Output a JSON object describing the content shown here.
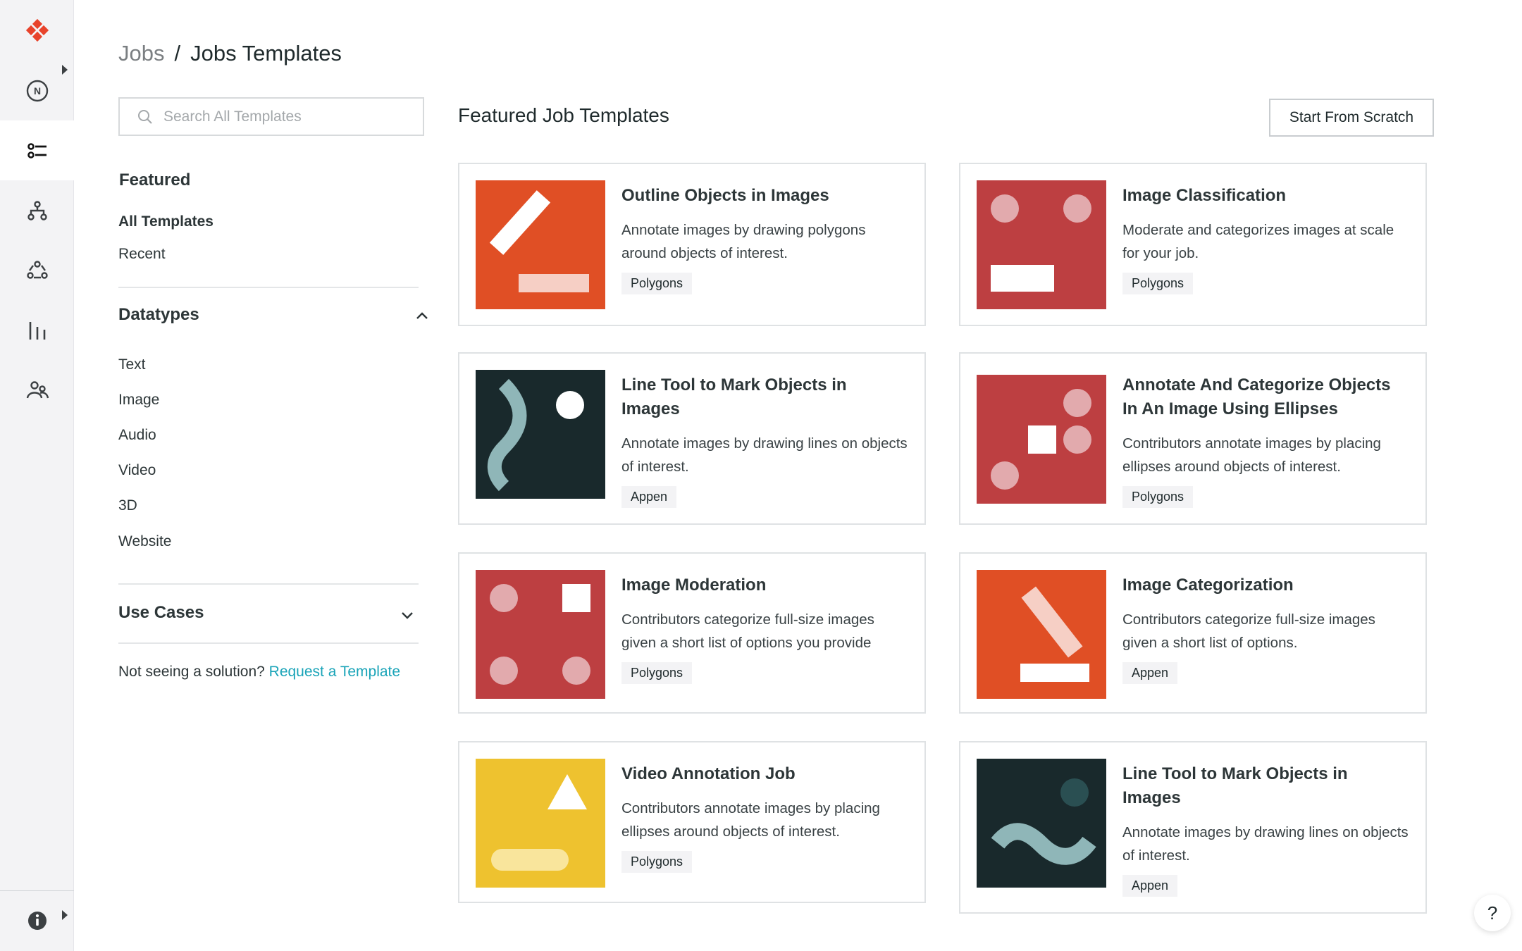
{
  "colors": {
    "brand": "#e8432b",
    "link": "#1aa4b8",
    "orange": "#e04f25",
    "red": "#bd3f41",
    "dark": "#19292c",
    "yellow": "#eec22f"
  },
  "rail": {
    "items": [
      {
        "icon": "appen-logo-icon"
      },
      {
        "icon": "notifications-n-icon"
      },
      {
        "icon": "jobs-list-icon",
        "active": true
      },
      {
        "icon": "workflows-hierarchy-icon"
      },
      {
        "icon": "teams-network-icon"
      },
      {
        "icon": "analytics-bars-icon"
      },
      {
        "icon": "users-icon"
      },
      {
        "icon": "info-icon"
      }
    ]
  },
  "breadcrumb": {
    "parent": "Jobs",
    "separator": "/",
    "current": "Jobs Templates"
  },
  "search": {
    "placeholder": "Search All Templates",
    "value": ""
  },
  "filters": {
    "featured_heading": "Featured",
    "featured_items": [
      "All Templates",
      "Recent"
    ],
    "datatypes_heading": "Datatypes",
    "datatypes_expanded": true,
    "datatypes": [
      "Text",
      "Image",
      "Audio",
      "Video",
      "3D",
      "Website"
    ],
    "use_cases_heading": "Use Cases",
    "use_cases_expanded": false,
    "footer_text": "Not seeing a solution?",
    "footer_link": "Request a Template"
  },
  "main": {
    "title": "Featured Job Templates",
    "start_button": "Start From Scratch",
    "cards": [
      {
        "title": "Outline Objects in Images",
        "description": "Annotate images by drawing polygons around objects of interest.",
        "tag": "Polygons",
        "art": "orange-bar"
      },
      {
        "title": "Image Classification",
        "description": "Moderate and categorizes images at scale for your job.",
        "tag": "Polygons",
        "art": "red-face"
      },
      {
        "title": "Line Tool to Mark Objects in Images",
        "description": "Annotate images by drawing lines on objects of interest.",
        "tag": "Appen",
        "art": "dark-wave-vertical"
      },
      {
        "title": "Annotate And Categorize Objects In An Image Using Ellipses",
        "description": "Contributors annotate images by placing ellipses around objects of interest.",
        "tag": "Polygons",
        "art": "red-ellipses"
      },
      {
        "title": "Image Moderation",
        "description": "Contributors categorize full-size images given a short list of options you provide",
        "tag": "Polygons",
        "art": "red-grid"
      },
      {
        "title": "Image Categorization",
        "description": "Contributors categorize full-size images given a short list of options.",
        "tag": "Appen",
        "art": "orange-bar-reverse"
      },
      {
        "title": "Video Annotation Job",
        "description": "Contributors annotate images by placing ellipses around objects of interest.",
        "tag": "Polygons",
        "art": "yellow-triangle"
      },
      {
        "title": "Line Tool to Mark Objects in Images",
        "description": "Annotate images by drawing lines on objects of interest.",
        "tag": "Appen",
        "art": "dark-wave-horizontal"
      }
    ]
  },
  "help": {
    "label": "?"
  }
}
